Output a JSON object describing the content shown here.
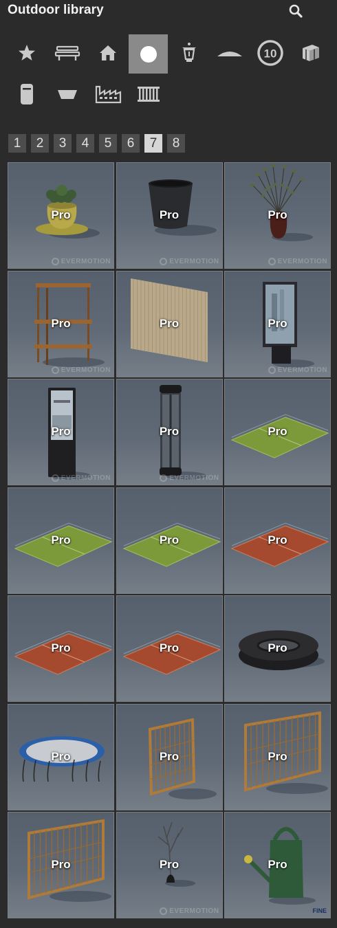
{
  "header": {
    "title": "Outdoor library",
    "search_icon": "search-icon"
  },
  "categories": [
    {
      "name": "star-icon",
      "active": false
    },
    {
      "name": "bench-icon",
      "active": false
    },
    {
      "name": "house-icon",
      "active": false
    },
    {
      "name": "circle-icon",
      "active": true
    },
    {
      "name": "lantern-icon",
      "active": false
    },
    {
      "name": "mound-icon",
      "active": false
    },
    {
      "name": "speed-sign-icon",
      "active": false,
      "label": "10"
    },
    {
      "name": "box-icon",
      "active": false
    },
    {
      "name": "bin-icon",
      "active": false
    },
    {
      "name": "planter-icon",
      "active": false
    },
    {
      "name": "factory-icon",
      "active": false
    },
    {
      "name": "fence-icon",
      "active": false
    }
  ],
  "pagination": {
    "pages": [
      "1",
      "2",
      "3",
      "4",
      "5",
      "6",
      "7",
      "8"
    ],
    "current": "7"
  },
  "items": [
    {
      "kind": "plant-pot",
      "badge": "Pro",
      "watermark": "EVERMOTION"
    },
    {
      "kind": "black-pot",
      "badge": "Pro",
      "watermark": "EVERMOTION"
    },
    {
      "kind": "vase-branches",
      "badge": "Pro",
      "watermark": "EVERMOTION"
    },
    {
      "kind": "shelf",
      "badge": "Pro",
      "watermark": "EVERMOTION"
    },
    {
      "kind": "panel",
      "badge": "Pro",
      "watermark": ""
    },
    {
      "kind": "billboard",
      "badge": "Pro",
      "watermark": "EVERMOTION"
    },
    {
      "kind": "totem",
      "badge": "Pro",
      "watermark": "EVERMOTION"
    },
    {
      "kind": "column-lamp",
      "badge": "Pro",
      "watermark": "EVERMOTION"
    },
    {
      "kind": "green-court",
      "badge": "Pro",
      "watermark": ""
    },
    {
      "kind": "green-court",
      "badge": "Pro",
      "watermark": ""
    },
    {
      "kind": "green-court",
      "badge": "Pro",
      "watermark": ""
    },
    {
      "kind": "clay-court",
      "badge": "Pro",
      "watermark": ""
    },
    {
      "kind": "clay-court",
      "badge": "Pro",
      "watermark": ""
    },
    {
      "kind": "clay-court",
      "badge": "Pro",
      "watermark": ""
    },
    {
      "kind": "tire",
      "badge": "Pro",
      "watermark": ""
    },
    {
      "kind": "trampoline",
      "badge": "Pro",
      "watermark": ""
    },
    {
      "kind": "fence-section",
      "badge": "Pro",
      "watermark": ""
    },
    {
      "kind": "fence-wide",
      "badge": "Pro",
      "watermark": ""
    },
    {
      "kind": "fence-wide",
      "badge": "Pro",
      "watermark": ""
    },
    {
      "kind": "bare-tree",
      "badge": "Pro",
      "watermark": "EVERMOTION"
    },
    {
      "kind": "watering-can",
      "badge": "Pro",
      "watermark": "FINE"
    }
  ]
}
